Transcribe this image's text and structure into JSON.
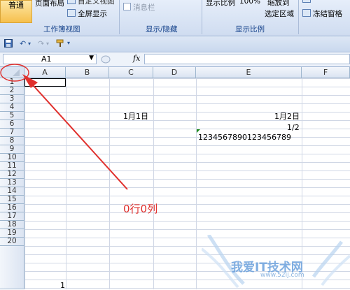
{
  "ribbon": {
    "normal_view": "普通",
    "page_layout": "页面布局",
    "custom_view_partial": "自定义视图",
    "full_screen": "全屏显示",
    "group_workbook_views": "工作簿视图",
    "message_bar": "消息栏",
    "group_show_hide": "显示/隐藏",
    "zoom_label": "显示比例",
    "zoom_value": "100%",
    "zoom_to_partial": "缩放到",
    "zoom_selection": "选定区域",
    "group_zoom": "显示比例",
    "freeze_panes": "冻结窗格"
  },
  "formula_bar": {
    "name_box": "A1",
    "fx": "fx"
  },
  "grid": {
    "columns": [
      "A",
      "B",
      "C",
      "D",
      "E",
      "F"
    ],
    "rows": [
      "1",
      "2",
      "3",
      "4",
      "5",
      "6",
      "7",
      "8",
      "9",
      "10",
      "11",
      "12",
      "13",
      "14",
      "15",
      "16",
      "17",
      "18",
      "19",
      "20"
    ],
    "cells": {
      "C4": "1月1日",
      "E4": "1月2日",
      "E5": "1/2",
      "E6": "1234567890123456789",
      "A20": "1"
    }
  },
  "annotation": {
    "text": "0行0列",
    "color": "#e0302d"
  },
  "watermark": {
    "text": "我爱IT技术网",
    "url": "www.52ij.com"
  }
}
